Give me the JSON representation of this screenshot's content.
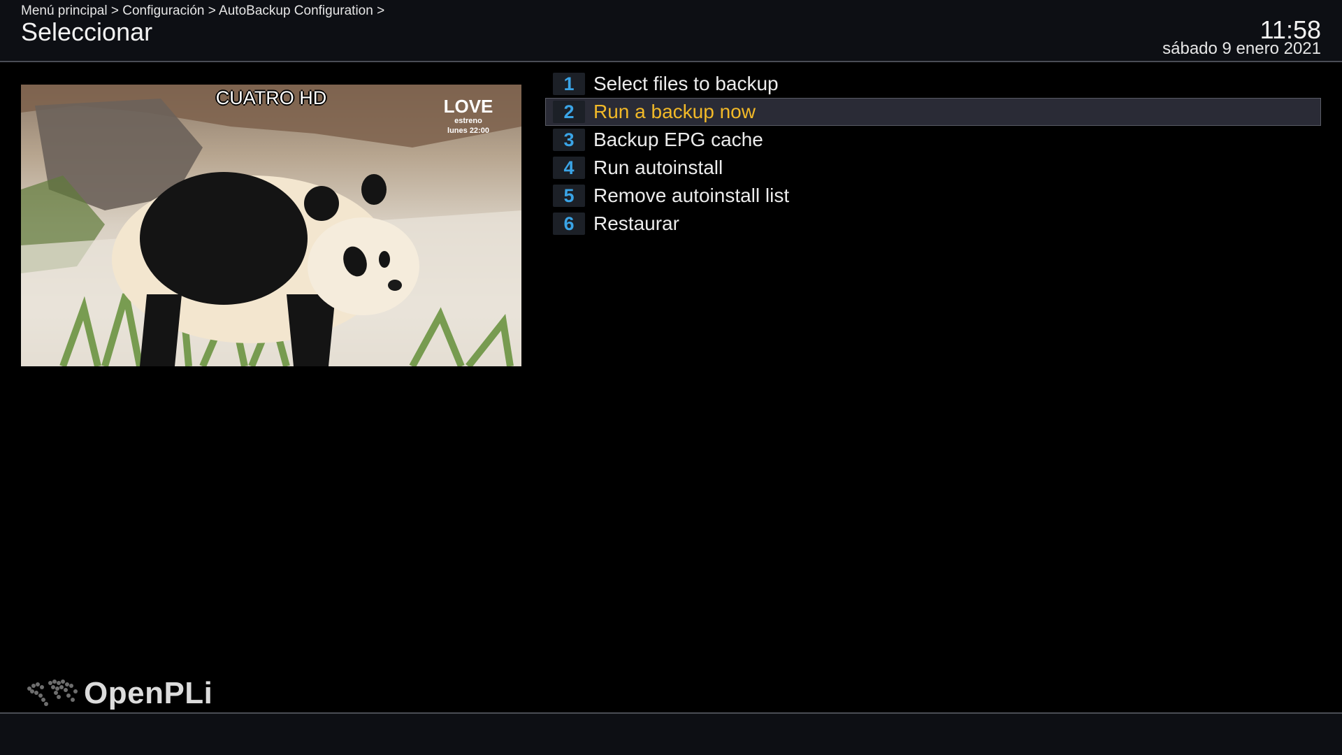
{
  "header": {
    "breadcrumb": "Menú principal > Configuración > AutoBackup Configuration >",
    "title": "Seleccionar",
    "time": "11:58",
    "date": "sábado  9 enero 2021"
  },
  "preview": {
    "channel_logo": "CUATRO HD",
    "promo_title": "LOVE",
    "promo_sub1": "estreno",
    "promo_sub2": "lunes 22:00"
  },
  "menu": {
    "items": [
      {
        "number": "1",
        "label": "Select files to backup"
      },
      {
        "number": "2",
        "label": "Run a backup now"
      },
      {
        "number": "3",
        "label": "Backup EPG cache"
      },
      {
        "number": "4",
        "label": "Run autoinstall"
      },
      {
        "number": "5",
        "label": "Remove autoinstall list"
      },
      {
        "number": "6",
        "label": "Restaurar"
      }
    ],
    "selected_index": 1
  },
  "footer": {
    "brand": "OpenPLi"
  },
  "colors": {
    "accent_number": "#3aa4e6",
    "selected_text": "#f2b928",
    "header_bg": "#0d0f14"
  }
}
